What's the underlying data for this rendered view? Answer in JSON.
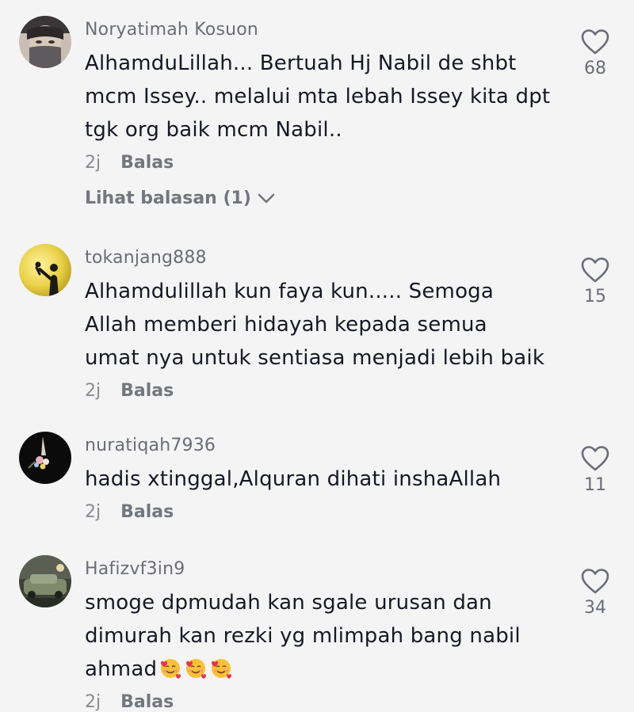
{
  "comments": [
    {
      "username": "Noryatimah Kosuon",
      "text": "AlhamduLillah... Bertuah Hj Nabil de shbt\nmcm Issey.. melalui mta lebah Issey kita dpt\ntgk org baik mcm Nabil..",
      "time": "2j",
      "reply_label": "Balas",
      "view_replies": "Lihat balasan (1)",
      "likes": "68"
    },
    {
      "username": "tokanjang888",
      "text": "Alhamdulillah kun faya kun..... Semoga\nAllah memberi hidayah kepada semua\numat nya untuk sentiasa menjadi lebih baik",
      "time": "2j",
      "reply_label": "Balas",
      "likes": "15"
    },
    {
      "username": "nuratiqah7936",
      "text": "hadis xtinggal,Alquran dihati inshaAllah",
      "time": "2j",
      "reply_label": "Balas",
      "likes": "11"
    },
    {
      "username": "Hafizvf3in9",
      "text": "smoge dpmudah kan sgale urusan dan\ndimurah kan rezki yg mlimpah bang nabil\nahmad",
      "emojis": [
        "smiling-face-with-hearts",
        "smiling-face-with-hearts",
        "smiling-face-with-hearts"
      ],
      "time": "2j",
      "reply_label": "Balas",
      "likes": "34"
    }
  ],
  "icons": {
    "like": "heart-outline-icon",
    "expand": "chevron-down-icon"
  },
  "colors": {
    "background": "#f4f4f4",
    "text": "#161823",
    "secondary": "#6b6d75"
  }
}
